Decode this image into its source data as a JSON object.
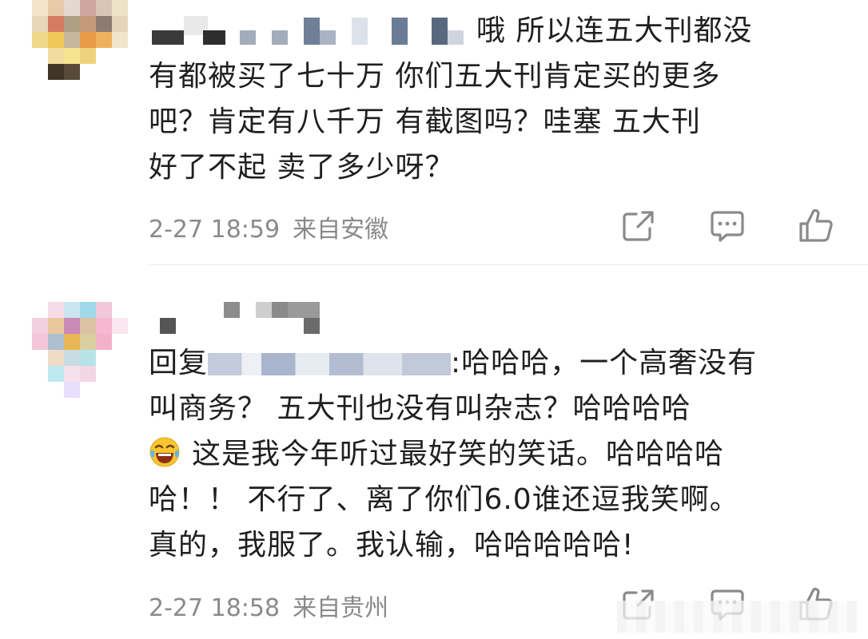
{
  "comments": [
    {
      "lines": [
        "哦  所以连五大刊都没",
        "有都被买了七十万  你们五大刊肯定买的更多",
        "吧？肯定有八千万  有截图吗？哇塞  五大刊",
        "好了不起  卖了多少呀？"
      ],
      "time": "2-27 18:59",
      "location": "来自安徽"
    },
    {
      "lines": [
        "回复",
        "哈哈哈，一个高奢没有",
        "叫商务？ 五大刊也没有叫杂志？哈哈哈哈",
        "这是我今年听过最好笑的笑话。哈哈哈哈",
        "哈！！  不行了、离了你们6.0谁还逗我笑啊。",
        "真的，我服了。我认输，哈哈哈哈哈!"
      ],
      "reply_separator": ":",
      "time": "2-27 18:58",
      "location": "来自贵州"
    }
  ],
  "icons": {
    "share": "share-icon",
    "comment": "comment-icon",
    "like": "thumbs-up-icon",
    "emoji": "laughing-crying-emoji-icon"
  },
  "colors": {
    "text": "#1f1f1f",
    "meta": "#8a8a8a",
    "icon": "#8a8a8a",
    "divider": "#ededed"
  }
}
